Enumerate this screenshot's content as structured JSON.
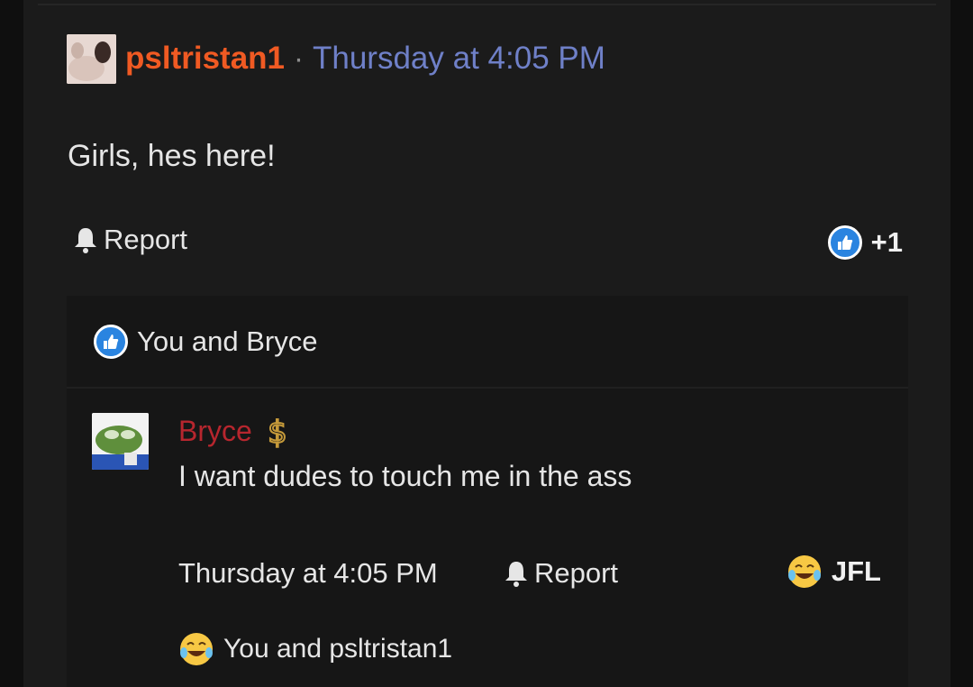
{
  "post": {
    "author": "psltristan1",
    "separator": "·",
    "timestamp": "Thursday at 4:05 PM",
    "body": "Girls, hes here!",
    "report_label": "Report",
    "reaction_count": "+1",
    "reactions_summary": "You and Bryce"
  },
  "reply": {
    "author": "Bryce",
    "text": "I want dudes to touch me in the ass",
    "timestamp": "Thursday at 4:05 PM",
    "report_label": "Report",
    "reaction_label": "JFL",
    "reactions_summary": "You and psltristan1"
  },
  "colors": {
    "author_main": "#f05a23",
    "timestamp_main": "#6f80c8",
    "author_reply": "#b7262e",
    "like_blue": "#2a84e0"
  },
  "icons": {
    "report": "bell-icon",
    "like": "thumbs-up-icon",
    "jfl": "laughing-crying-emoji-icon",
    "badge": "dollar-icon"
  }
}
